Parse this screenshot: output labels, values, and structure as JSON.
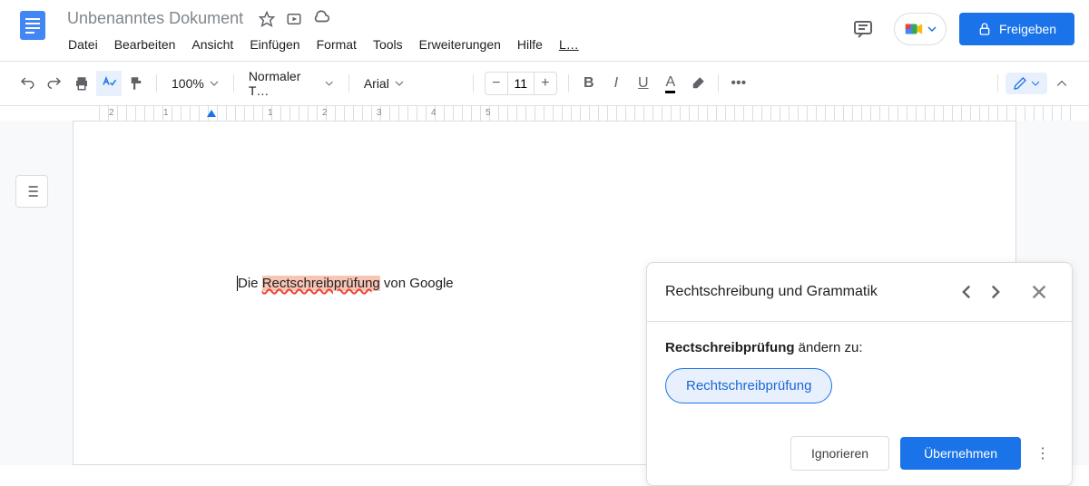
{
  "header": {
    "title": "Unbenanntes Dokument",
    "share_label": "Freigeben"
  },
  "menubar": {
    "file": "Datei",
    "edit": "Bearbeiten",
    "view": "Ansicht",
    "insert": "Einfügen",
    "format": "Format",
    "tools": "Tools",
    "extensions": "Erweiterungen",
    "help": "Hilfe",
    "last": "L…"
  },
  "toolbar": {
    "zoom": "100%",
    "style": "Normaler T…",
    "font": "Arial",
    "font_size": "11"
  },
  "ruler": {
    "m2": "2",
    "m1": "1",
    "p1": "1",
    "p2": "2",
    "p3": "3",
    "p4": "4",
    "p5": "5"
  },
  "document": {
    "before": "Die ",
    "error": "Rectschreibprüfung",
    "after": " von Google"
  },
  "spellcheck": {
    "title": "Rechtschreibung und Grammatik",
    "word": "Rectschreibprüfung",
    "change_to": " ändern zu:",
    "suggestion": "Rechtschreibprüfung",
    "ignore": "Ignorieren",
    "accept": "Übernehmen"
  }
}
